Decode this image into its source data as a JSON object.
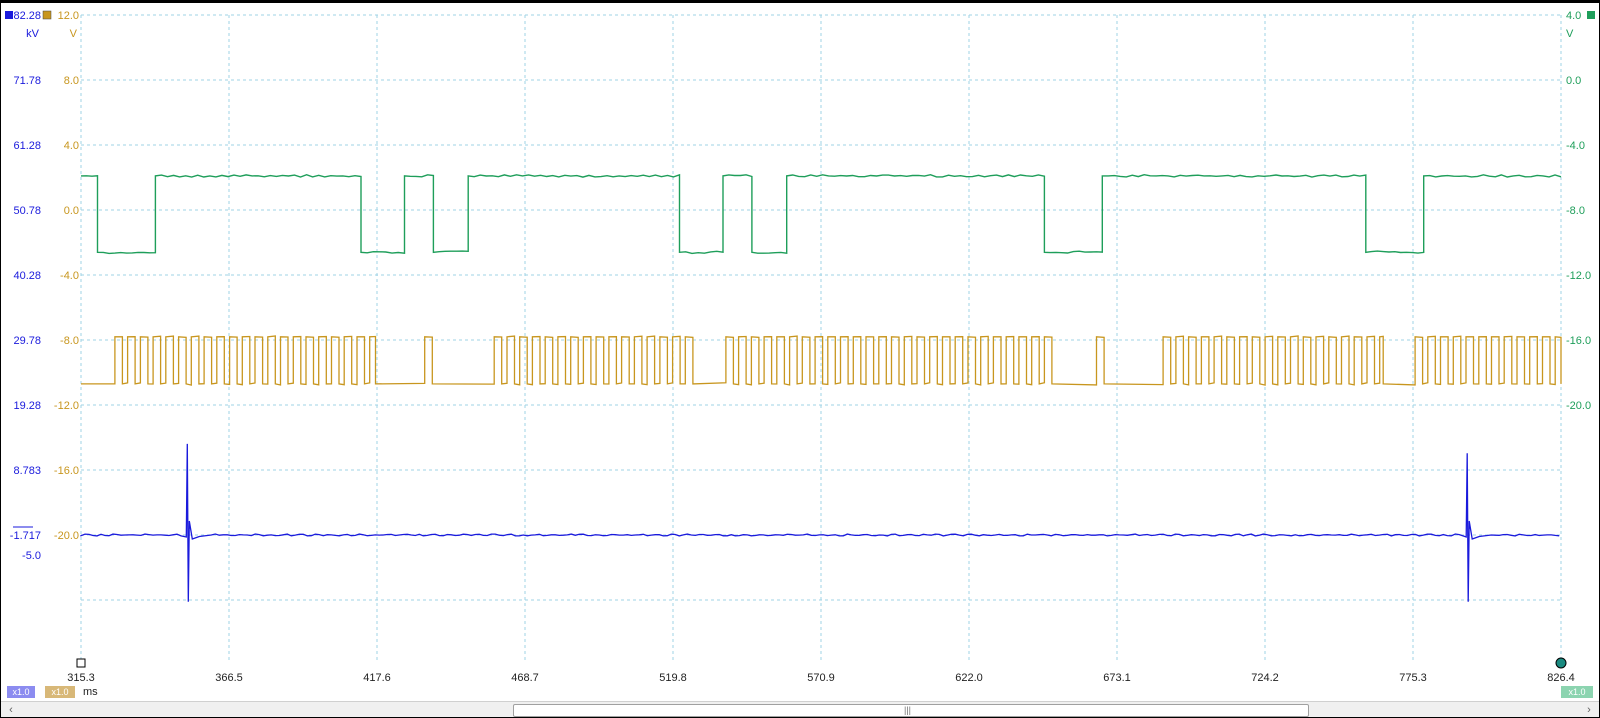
{
  "chart_data": {
    "type": "line",
    "x_unit": "ms",
    "x_ticks": [
      "315.3",
      "366.5",
      "417.6",
      "468.7",
      "519.8",
      "570.9",
      "622.0",
      "673.1",
      "724.2",
      "775.3",
      "826.4"
    ],
    "xlim": [
      315.3,
      826.4
    ],
    "grid": true,
    "axes": {
      "left_blue": {
        "unit": "kV",
        "ticks": [
          "82.28",
          "71.78",
          "61.28",
          "50.78",
          "40.28",
          "29.78",
          "19.28",
          "8.783",
          "-1.717"
        ],
        "extra_label": "-5.0",
        "color": "#1a1adc"
      },
      "left_gold": {
        "unit": "V",
        "ticks": [
          "12.0",
          "8.0",
          "4.0",
          "0.0",
          "-4.0",
          "-8.0",
          "-12.0",
          "-16.0",
          "-20.0"
        ],
        "color": "#c8961e"
      },
      "right_green": {
        "unit": "V",
        "ticks": [
          "4.0",
          "0.0",
          "-4.0",
          "-8.0",
          "-12.0",
          "-16.0",
          "-20.0"
        ],
        "color": "#1e9e5a"
      }
    },
    "series": [
      {
        "axis": "right_green",
        "color": "#1e9e5a",
        "kind": "square",
        "high": -5.9,
        "low": -10.6,
        "transitions": [
          [
            315.3,
            "high"
          ],
          [
            321.0,
            "low"
          ],
          [
            341.0,
            "high"
          ],
          [
            412.0,
            "low"
          ],
          [
            427.0,
            "high"
          ],
          [
            437.0,
            "low"
          ],
          [
            449.0,
            "high"
          ],
          [
            522.0,
            "low"
          ],
          [
            537.0,
            "high"
          ],
          [
            547.0,
            "low"
          ],
          [
            559.0,
            "high"
          ],
          [
            648.0,
            "low"
          ],
          [
            668.0,
            "high"
          ],
          [
            759.0,
            "low"
          ],
          [
            779.0,
            "high"
          ],
          [
            826.4,
            "end"
          ]
        ]
      },
      {
        "axis": "left_gold",
        "color": "#c8961e",
        "kind": "pulse_train",
        "high": -7.8,
        "low": -10.7,
        "pulse_groups": [
          {
            "start": 327.0,
            "end": 417.0,
            "period": 4.4,
            "width": 2.6
          },
          {
            "start": 434.0,
            "end": 437.0,
            "period": 4.4,
            "width": 2.6
          },
          {
            "start": 458.0,
            "end": 527.0,
            "period": 4.4,
            "width": 2.6
          },
          {
            "start": 538.0,
            "end": 652.0,
            "period": 4.4,
            "width": 2.6
          },
          {
            "start": 666.0,
            "end": 670.0,
            "period": 4.4,
            "width": 2.6
          },
          {
            "start": 689.0,
            "end": 765.0,
            "period": 4.4,
            "width": 2.6
          },
          {
            "start": 776.0,
            "end": 826.4,
            "period": 4.4,
            "width": 2.6
          }
        ]
      },
      {
        "axis": "left_blue",
        "color": "#1a1adc",
        "kind": "baseline_spikes",
        "baseline": -1.717,
        "spikes": [
          {
            "x": 352.0,
            "peak": 13.0,
            "dip": -12.5
          },
          {
            "x": 794.0,
            "peak": 11.5,
            "dip": -12.5
          }
        ]
      }
    ]
  }
}
